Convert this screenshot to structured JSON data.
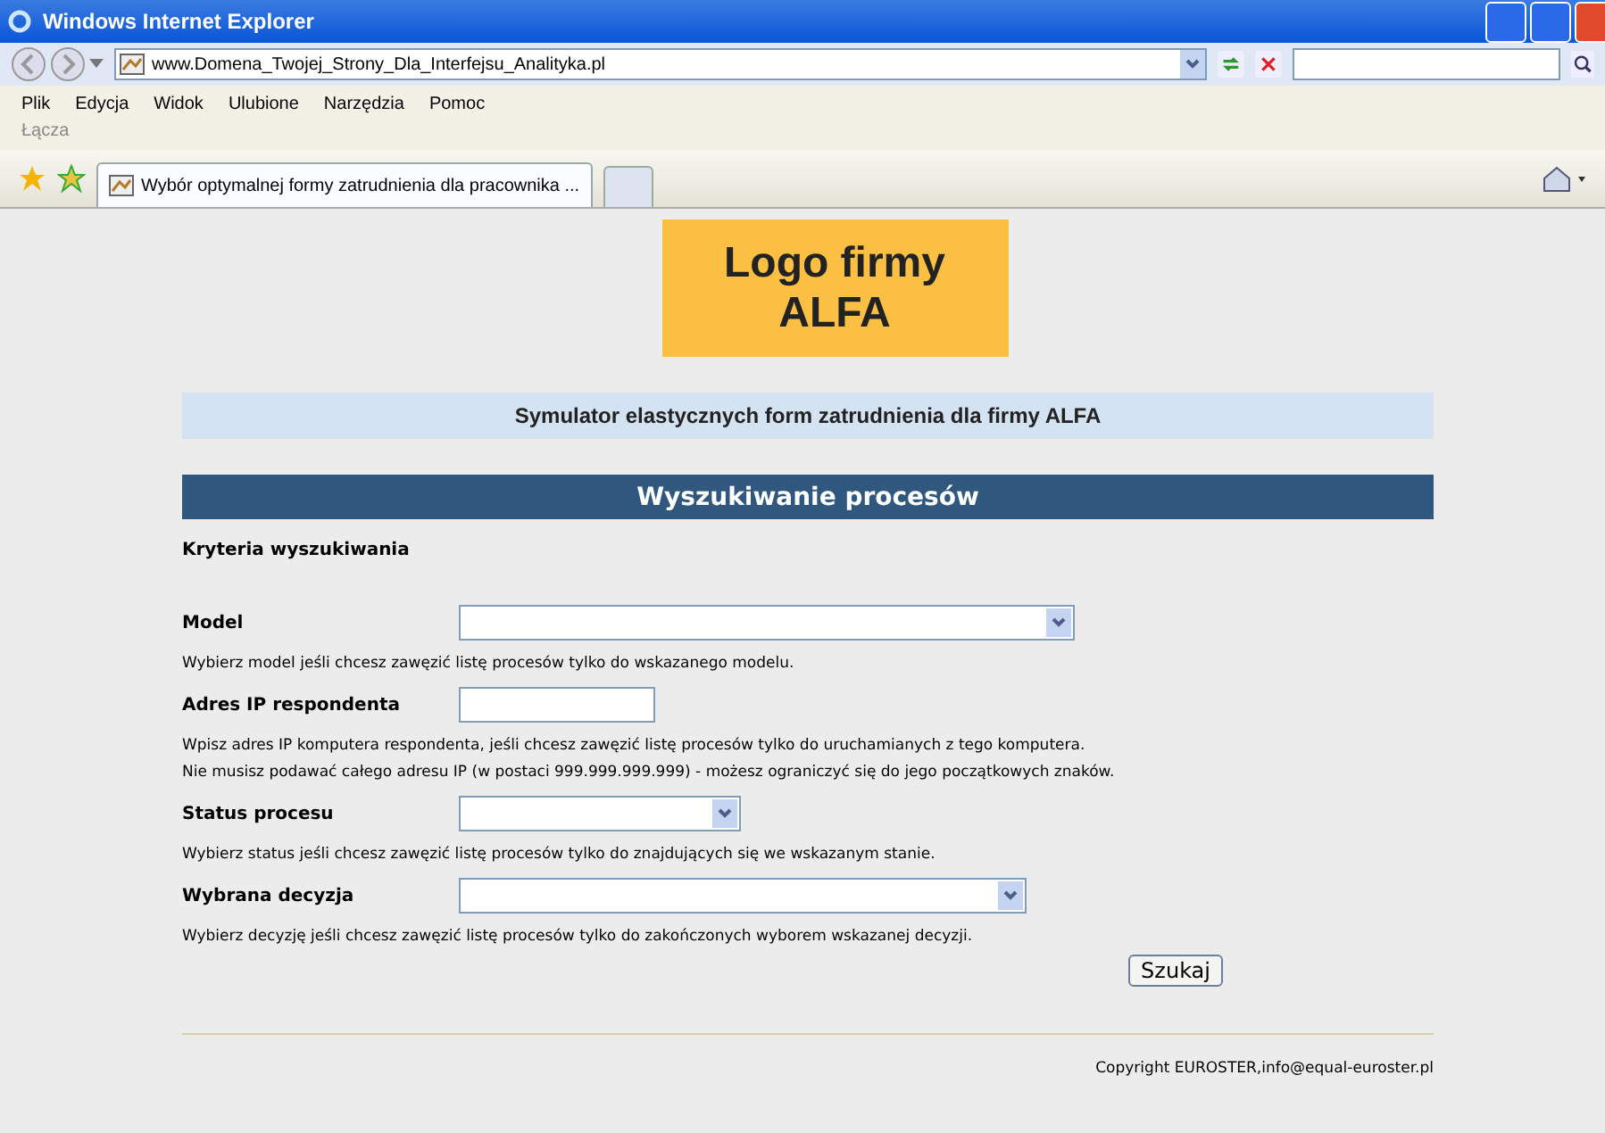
{
  "window": {
    "title": "Windows Internet Explorer"
  },
  "address_bar": {
    "url": "www.Domena_Twojej_Strony_Dla_Interfejsu_Analityka.pl"
  },
  "menu": [
    "Plik",
    "Edycja",
    "Widok",
    "Ulubione",
    "Narzędzia",
    "Pomoc"
  ],
  "links_bar": {
    "label": "Łącza"
  },
  "tabs": [
    {
      "label": "Wybór optymalnej formy zatrudnienia dla pracownika ...",
      "selected": true
    }
  ],
  "page": {
    "logo": [
      "Logo firmy",
      "ALFA"
    ],
    "subtitle": "Symulator elastycznych form zatrudnienia dla firmy ALFA",
    "heading": "Wyszukiwanie procesów",
    "section": "Kryteria wyszukiwania",
    "fields": [
      {
        "kind": "select",
        "label": "Model",
        "hints": [
          "Wybierz model jeśli chcesz zawęzić listę procesów tylko do wskazanego modelu."
        ]
      },
      {
        "kind": "text",
        "label": "Adres IP respondenta",
        "hints": [
          "Wpisz adres IP komputera respondenta, jeśli chcesz zawęzić listę procesów tylko do uruchamianych z tego komputera.",
          "Nie musisz podawać całego adresu IP (w postaci 999.999.999.999) - możesz ograniczyć się do jego początkowych znaków."
        ]
      },
      {
        "kind": "select",
        "label": "Status procesu",
        "hints": [
          "Wybierz status jeśli chcesz zawęzić listę procesów tylko do znajdujących się we wskazanym stanie."
        ]
      },
      {
        "kind": "select",
        "label": "Wybrana decyzja",
        "hints": [
          "Wybierz decyzję jeśli chcesz zawęzić listę procesów tylko do zakończonych wyborem wskazanej decyzji."
        ]
      }
    ],
    "search_button": "Szukaj",
    "footer": "Copyright EUROSTER,info@equal-euroster.pl"
  }
}
